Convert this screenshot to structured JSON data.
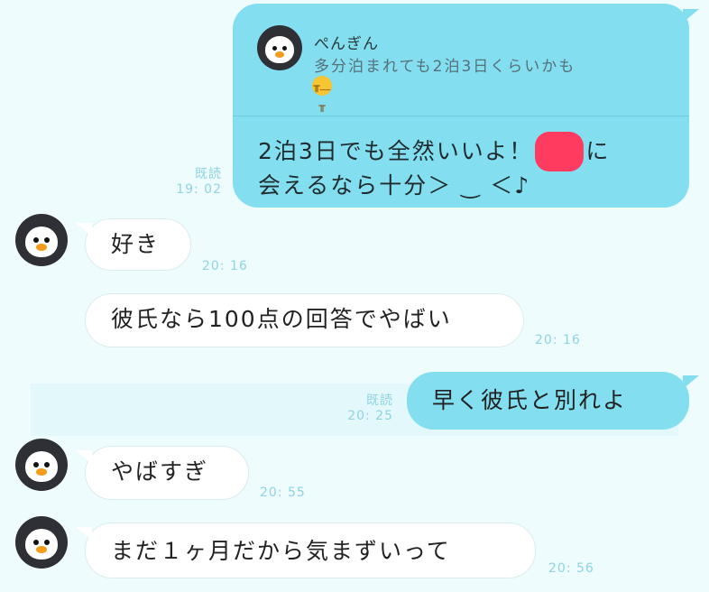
{
  "colors": {
    "background": "#eefcfe",
    "outgoing_bubble": "#83def0",
    "incoming_bubble": "#ffffff",
    "meta_text": "#8fd3e2",
    "redaction": "#ff3b5f",
    "avatar": "#2e3035"
  },
  "reply_message": {
    "quote": {
      "sender": "ぺんぎん",
      "text": "多分泊まれても2泊3日くらいかも",
      "emoji_icon": "crying-face-icon"
    },
    "text_line1_before": "2泊3日でも全然いいよ！",
    "text_line1_after": "に",
    "text_line2": "会えるなら十分＞ ‿ ＜♪",
    "read_label": "既読",
    "time": "19: 02"
  },
  "messages": [
    {
      "text": "好き",
      "time": "20: 16",
      "avatar": "penguin-avatar"
    },
    {
      "text": "彼氏なら100点の回答でやばい",
      "time": "20: 16"
    },
    {
      "text": "早く彼氏と別れよ",
      "time": "20: 25",
      "read_label": "既読"
    },
    {
      "text": "やばすぎ",
      "time": "20: 55",
      "avatar": "penguin-avatar"
    },
    {
      "text": "まだ１ヶ月だから気まずいって",
      "time": "20: 56",
      "avatar": "penguin-avatar"
    }
  ]
}
